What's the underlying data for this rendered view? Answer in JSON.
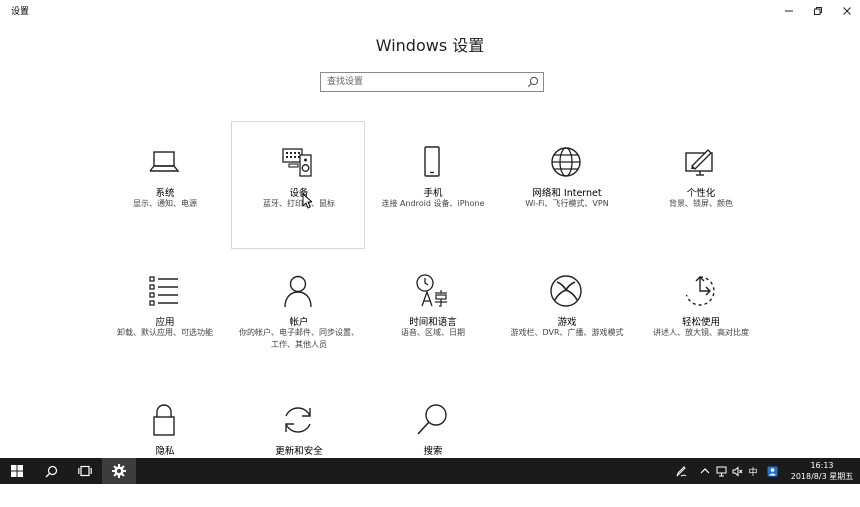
{
  "window": {
    "title": "设置",
    "minimize_icon": "minimize-icon",
    "restore_icon": "restore-icon",
    "close_icon": "close-icon"
  },
  "main": {
    "heading": "Windows 设置",
    "search": {
      "placeholder": "查找设置",
      "icon": "search-icon"
    }
  },
  "tiles": [
    {
      "id": "system",
      "icon": "laptop-icon",
      "name": "系统",
      "desc": "显示、通知、电源"
    },
    {
      "id": "devices",
      "icon": "keyboard-speaker-icon",
      "name": "设备",
      "desc": "蓝牙、打印机、鼠标"
    },
    {
      "id": "phone",
      "icon": "phone-icon",
      "name": "手机",
      "desc": "连接 Android 设备、iPhone"
    },
    {
      "id": "network",
      "icon": "globe-icon",
      "name": "网络和 Internet",
      "desc": "Wi-Fi、飞行模式、VPN"
    },
    {
      "id": "personalization",
      "icon": "paint-pen-icon",
      "name": "个性化",
      "desc": "背景、锁屏、颜色"
    },
    {
      "id": "apps",
      "icon": "apps-list-icon",
      "name": "应用",
      "desc": "卸载、默认应用、可选功能"
    },
    {
      "id": "accounts",
      "icon": "person-icon",
      "name": "帐户",
      "desc": "你的帐户、电子邮件、同步设置、工作、其他人员"
    },
    {
      "id": "time-language",
      "icon": "clock-language-icon",
      "name": "时间和语言",
      "desc": "语音、区域、日期"
    },
    {
      "id": "gaming",
      "icon": "xbox-icon",
      "name": "游戏",
      "desc": "游戏栏、DVR、广播、游戏模式"
    },
    {
      "id": "ease-of-access",
      "icon": "ease-of-access-icon",
      "name": "轻松使用",
      "desc": "讲述人、放大镜、高对比度"
    },
    {
      "id": "privacy",
      "icon": "lock-icon",
      "name": "隐私",
      "desc": ""
    },
    {
      "id": "update-security",
      "icon": "refresh-icon",
      "name": "更新和安全",
      "desc": ""
    },
    {
      "id": "search",
      "icon": "magnifier-icon",
      "name": "搜索",
      "desc": ""
    }
  ],
  "taskbar": {
    "start_icon": "windows-logo-icon",
    "search_icon": "search-icon",
    "task_view_icon": "task-view-icon",
    "settings_icon": "gear-icon",
    "tray": {
      "pen_icon": "pen-icon",
      "chevron_icon": "chevron-up-icon",
      "network_icon": "network-icon",
      "volume_icon": "volume-icon",
      "ime_label": "中",
      "input_icon": "input-icon",
      "time": "16:13",
      "date": "2018/8/3 星期五",
      "notification_icon": "notification-icon"
    }
  },
  "colors": {
    "background": "#ffffff",
    "taskbar": "#1b1b1b",
    "tile_hover_border": "#d6d6d6",
    "text": "#000000"
  }
}
